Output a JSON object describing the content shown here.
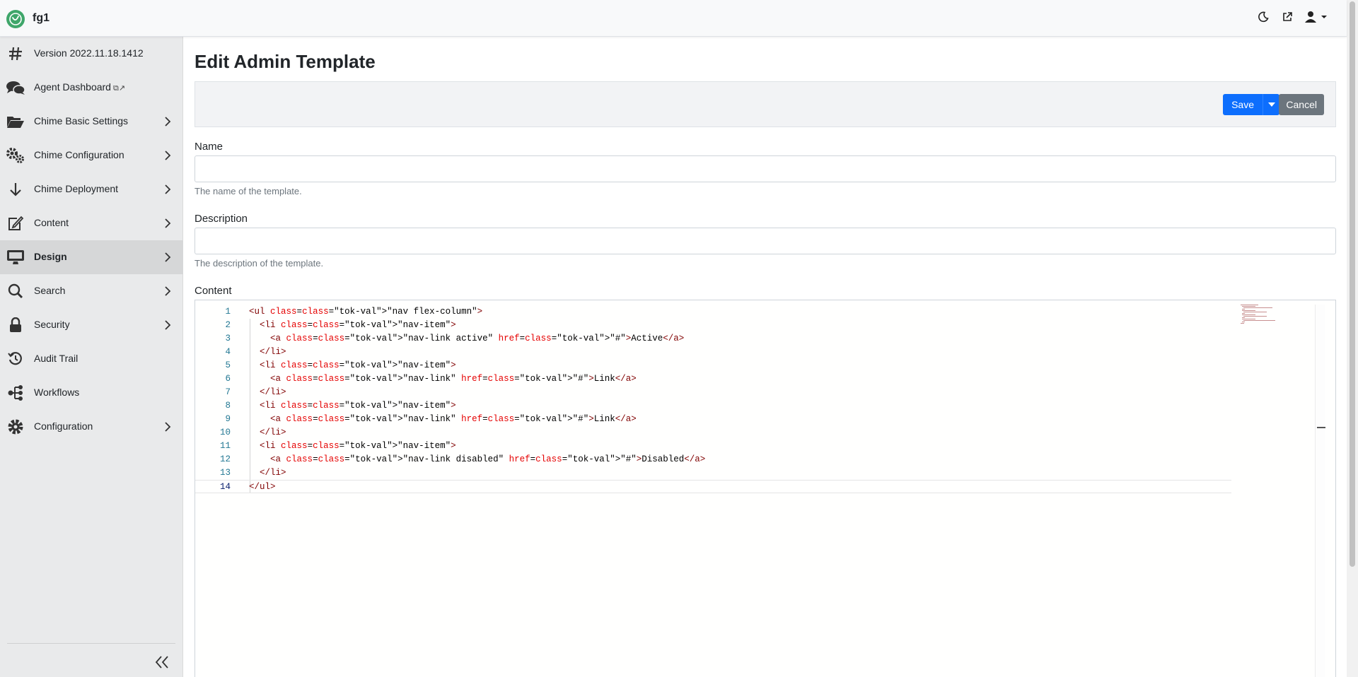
{
  "app": {
    "brand": "fg1"
  },
  "sidebar": {
    "items": [
      {
        "label": "Version 2022.11.18.1412",
        "icon": "hash-icon",
        "chevron": false
      },
      {
        "label": "Agent Dashboard",
        "icon": "chat-bubbles-icon",
        "chevron": false,
        "external": "⧉↗"
      },
      {
        "label": "Chime Basic Settings",
        "icon": "folder-open-icon",
        "chevron": true
      },
      {
        "label": "Chime Configuration",
        "icon": "gears-icon",
        "chevron": true
      },
      {
        "label": "Chime Deployment",
        "icon": "arrow-down-icon",
        "chevron": true
      },
      {
        "label": "Content",
        "icon": "edit-icon",
        "chevron": true
      },
      {
        "label": "Design",
        "icon": "monitor-icon",
        "chevron": true,
        "active": true
      },
      {
        "label": "Search",
        "icon": "search-icon",
        "chevron": true
      },
      {
        "label": "Security",
        "icon": "lock-icon",
        "chevron": true
      },
      {
        "label": "Audit Trail",
        "icon": "history-icon",
        "chevron": false
      },
      {
        "label": "Workflows",
        "icon": "workflow-icon",
        "chevron": false
      },
      {
        "label": "Configuration",
        "icon": "gear-icon",
        "chevron": true
      }
    ]
  },
  "main": {
    "title": "Edit Admin Template",
    "toolbar": {
      "save_label": "Save",
      "cancel_label": "Cancel"
    },
    "fields": {
      "name": {
        "label": "Name",
        "value": "",
        "help": "The name of the template."
      },
      "description": {
        "label": "Description",
        "value": "",
        "help": "The description of the template."
      },
      "content": {
        "label": "Content"
      }
    },
    "editor": {
      "current_line": 14,
      "lines": [
        "<ul class=\"nav flex-column\">",
        "  <li class=\"nav-item\">",
        "    <a class=\"nav-link active\" href=\"#\">Active</a>",
        "  </li>",
        "  <li class=\"nav-item\">",
        "    <a class=\"nav-link\" href=\"#\">Link</a>",
        "  </li>",
        "  <li class=\"nav-item\">",
        "    <a class=\"nav-link\" href=\"#\">Link</a>",
        "  </li>",
        "  <li class=\"nav-item\">",
        "    <a class=\"nav-link disabled\" href=\"#\">Disabled</a>",
        "  </li>",
        "</ul>"
      ]
    }
  },
  "colors": {
    "primary": "#0d6efd",
    "secondary": "#6c757d",
    "brand_green": "#3fa66a",
    "sidebar_bg": "#e9eaeb",
    "sidebar_active": "#d6d7d8"
  }
}
